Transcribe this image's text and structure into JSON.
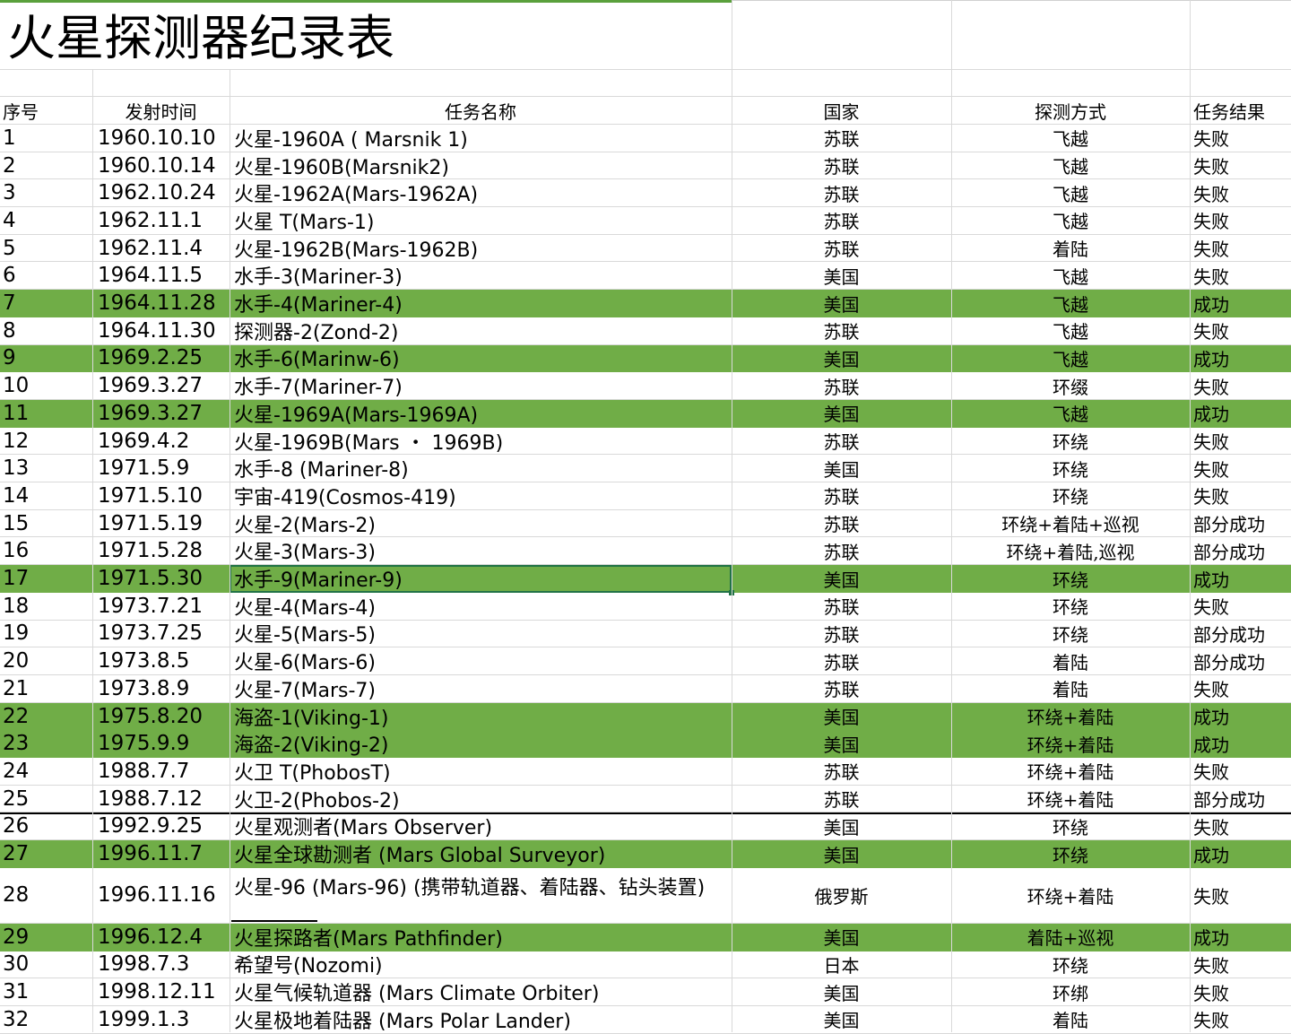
{
  "sheet": {
    "title": "火星探测器纪录表",
    "headers": [
      "序号",
      "发射时间",
      "任务名称",
      "国家",
      "探测方式",
      "任务结果"
    ],
    "rows": [
      {
        "no": "1",
        "date": "1960.10.10",
        "name": "火星-1960A ( Marsnik 1)",
        "country": "苏联",
        "method": "飞越",
        "result": "失败",
        "highlight": false
      },
      {
        "no": "2",
        "date": "1960.10.14",
        "name": "火星-1960B(Marsnik2)",
        "country": "苏联",
        "method": "飞越",
        "result": "失败",
        "highlight": false
      },
      {
        "no": "3",
        "date": "1962.10.24",
        "name": "火星-1962A(Mars-1962A)",
        "country": "苏联",
        "method": "飞越",
        "result": "失败",
        "highlight": false
      },
      {
        "no": "4",
        "date": "1962.11.1",
        "name": "火星 T(Mars-1)",
        "country": "苏联",
        "method": "飞越",
        "result": "失败",
        "highlight": false
      },
      {
        "no": "5",
        "date": "1962.11.4",
        "name": "火星-1962B(Mars-1962B)",
        "country": "苏联",
        "method": "着陆",
        "result": "失败",
        "highlight": false
      },
      {
        "no": "6",
        "date": "1964.11.5",
        "name": "水手-3(Mariner-3)",
        "country": "美国",
        "method": "飞越",
        "result": "失败",
        "highlight": false
      },
      {
        "no": "7",
        "date": "1964.11.28",
        "name": "水手-4(Mariner-4)",
        "country": "美国",
        "method": "飞越",
        "result": "成功",
        "highlight": true
      },
      {
        "no": "8",
        "date": "1964.11.30",
        "name": "探测器-2(Zond-2)",
        "country": "苏联",
        "method": "飞越",
        "result": "失败",
        "highlight": false
      },
      {
        "no": "9",
        "date": "1969.2.25",
        "name": "水手-6(Marinw-6)",
        "country": "美国",
        "method": "飞越",
        "result": "成功",
        "highlight": true
      },
      {
        "no": "10",
        "date": "1969.3.27",
        "name": "水手-7(Mariner-7)",
        "country": "苏联",
        "method": "环缀",
        "result": "失败",
        "highlight": false
      },
      {
        "no": "11",
        "date": "1969.3.27",
        "name": "火星-1969A(Mars-1969A)",
        "country": "美国",
        "method": "飞越",
        "result": "成功",
        "highlight": true
      },
      {
        "no": "12",
        "date": "1969.4.2",
        "name": "火星-1969B(Mars ・ 1969B)",
        "country": "苏联",
        "method": "环绕",
        "result": "失败",
        "highlight": false
      },
      {
        "no": "13",
        "date": "1971.5.9",
        "name": "水手-8 (Mariner-8)",
        "country": "美国",
        "method": "环绕",
        "result": "失败",
        "highlight": false
      },
      {
        "no": "14",
        "date": "1971.5.10",
        "name": "宇宙-419(Cosmos-419)",
        "country": "苏联",
        "method": "环绕",
        "result": "失败",
        "highlight": false
      },
      {
        "no": "15",
        "date": "1971.5.19",
        "name": "火星-2(Mars-2)",
        "country": "苏联",
        "method": "环绕+着陆+巡视",
        "result": "部分成功",
        "highlight": false
      },
      {
        "no": "16",
        "date": "1971.5.28",
        "name": "火星-3(Mars-3)",
        "country": "苏联",
        "method": "环绕+着陆,巡视",
        "result": "部分成功",
        "highlight": false
      },
      {
        "no": "17",
        "date": "1971.5.30",
        "name": "水手-9(Mariner-9)",
        "country": "美国",
        "method": "环绕",
        "result": "成功",
        "highlight": true
      },
      {
        "no": "18",
        "date": "1973.7.21",
        "name": "火星-4(Mars-4)",
        "country": "苏联",
        "method": "环绕",
        "result": "失败",
        "highlight": false
      },
      {
        "no": "19",
        "date": "1973.7.25",
        "name": "火星-5(Mars-5)",
        "country": "苏联",
        "method": "环绕",
        "result": "部分成功",
        "highlight": false
      },
      {
        "no": "20",
        "date": "1973.8.5",
        "name": "火星-6(Mars-6)",
        "country": "苏联",
        "method": "着陆",
        "result": "部分成功",
        "highlight": false
      },
      {
        "no": "21",
        "date": "1973.8.9",
        "name": "火星-7(Mars-7)",
        "country": "苏联",
        "method": "着陆",
        "result": "失败",
        "highlight": false
      },
      {
        "no": "22",
        "date": "1975.8.20",
        "name": "海盗-1(Viking-1)",
        "country": "美国",
        "method": "环绕+着陆",
        "result": "成功",
        "highlight": true
      },
      {
        "no": "23",
        "date": "1975.9.9",
        "name": "海盗-2(Viking-2)",
        "country": "美国",
        "method": "环绕+着陆",
        "result": "成功",
        "highlight": true
      },
      {
        "no": "24",
        "date": "1988.7.7",
        "name": "火卫 T(PhobosT)",
        "country": "苏联",
        "method": "环绕+着陆",
        "result": "失败",
        "highlight": false
      },
      {
        "no": "25",
        "date": "1988.7.12",
        "name": "火卫-2(Phobos-2)",
        "country": "苏联",
        "method": "环绕+着陆",
        "result": "部分成功",
        "highlight": false
      },
      {
        "no": "26",
        "date": "1992.9.25",
        "name": "火星观测者(Mars Observer)",
        "country": "美国",
        "method": "环绕",
        "result": "失败",
        "highlight": false
      },
      {
        "no": "27",
        "date": "1996.11.7",
        "name": "火星全球勘测者 (Mars Global Surveyor)",
        "country": "美国",
        "method": "环绕",
        "result": "成功",
        "highlight": true
      },
      {
        "no": "28",
        "date": "1996.11.16",
        "name": "火星-96 (Mars-96) (携带轨道器、着陆器、钻头装置)",
        "country": "俄罗斯",
        "method": "环绕+着陆",
        "result": "失败",
        "highlight": false
      },
      {
        "no": "29",
        "date": "1996.12.4",
        "name": "火星探路者(Mars Pathfinder)",
        "country": "美国",
        "method": "着陆+巡视",
        "result": "成功",
        "highlight": true
      },
      {
        "no": "30",
        "date": "1998.7.3",
        "name": "希望号(Nozomi)",
        "country": "日本",
        "method": "环绕",
        "result": "失败",
        "highlight": false
      },
      {
        "no": "31",
        "date": "1998.12.11",
        "name": "火星气候轨道器 (Mars Climate Orbiter)",
        "country": "美国",
        "method": "环绑",
        "result": "失败",
        "highlight": false
      },
      {
        "no": "32",
        "date": "1999.1.3",
        "name": "火星极地着陆器 (Mars Polar Lander)",
        "country": "美国",
        "method": "着陆",
        "result": "失败",
        "highlight": false
      }
    ],
    "colors": {
      "highlight": "#70ad47",
      "grid": "#d9d9d9",
      "selection": "#217346"
    }
  }
}
